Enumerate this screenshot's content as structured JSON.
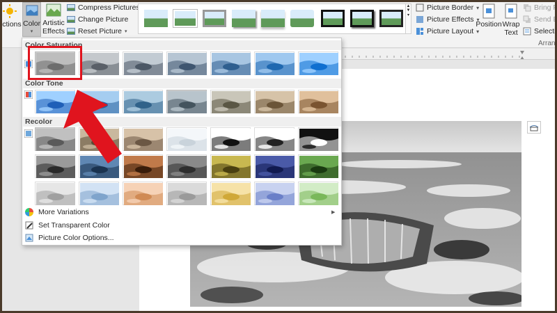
{
  "ribbon": {
    "corrections_label": "ections",
    "color_label": "Color",
    "artistic_effects": [
      "Artistic",
      "Effects"
    ],
    "compress_pictures": "Compress Pictures",
    "change_picture": "Change Picture",
    "reset_picture": "Reset Picture",
    "picture_border": "Picture Border",
    "picture_effects": "Picture Effects",
    "picture_layout": "Picture Layout",
    "position": "Position",
    "wrap_text": [
      "Wrap",
      "Text"
    ],
    "bring_forward": "Bring For",
    "send_back": "Send Ba",
    "selection": "Selection",
    "arrange": "Arrange"
  },
  "dropdown": {
    "color_saturation": "Color Saturation",
    "color_tone": "Color Tone",
    "recolor": "Recolor",
    "more_variations": "More Variations",
    "set_transparent_color": "Set Transparent Color",
    "picture_color_options": "Picture Color Options..."
  },
  "colors": {
    "accent_red": "#e0141e",
    "ribbon_bg": "#f3f3f3"
  },
  "state": {
    "selected_saturation_index": 0,
    "selected_tone_index": 3,
    "selected_recolor_index": 0
  }
}
